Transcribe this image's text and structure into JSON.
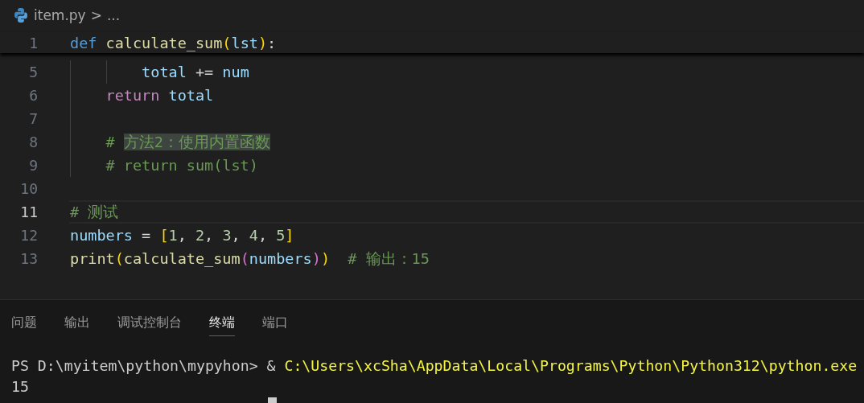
{
  "breadcrumb": {
    "file": "item.py",
    "separator": ">",
    "more": "..."
  },
  "sticky_line": {
    "number": "1",
    "tokens": [
      {
        "text": "def ",
        "kind": "keyword"
      },
      {
        "text": "calculate_sum",
        "kind": "function"
      },
      {
        "text": "(",
        "kind": "bracket"
      },
      {
        "text": "lst",
        "kind": "variable"
      },
      {
        "text": ")",
        "kind": "bracket"
      },
      {
        "text": ":",
        "kind": "plain"
      }
    ]
  },
  "lines": [
    {
      "number": "5",
      "current": false,
      "tokens": [
        {
          "text": "        total",
          "kind": "variable"
        },
        {
          "text": " += ",
          "kind": "plain"
        },
        {
          "text": "num",
          "kind": "variable"
        }
      ]
    },
    {
      "number": "6",
      "current": false,
      "tokens": [
        {
          "text": "    return",
          "kind": "control"
        },
        {
          "text": " total",
          "kind": "variable"
        }
      ]
    },
    {
      "number": "7",
      "current": false
    },
    {
      "number": "8",
      "current": false,
      "tokens": [
        {
          "text": "    # ",
          "kind": "comment"
        },
        {
          "text": "方法2：使用内置函数",
          "kind": "comment_highlight"
        }
      ]
    },
    {
      "number": "9",
      "current": false,
      "tokens": [
        {
          "text": "    # return sum(lst)",
          "kind": "comment"
        }
      ]
    },
    {
      "number": "10",
      "current": false
    },
    {
      "number": "11",
      "current": true,
      "tokens": [
        {
          "text": "# 测试",
          "kind": "comment"
        }
      ]
    },
    {
      "number": "12",
      "current": false,
      "tokens": [
        {
          "text": "numbers",
          "kind": "variable"
        },
        {
          "text": " = ",
          "kind": "plain"
        },
        {
          "text": "[",
          "kind": "bracket"
        },
        {
          "text": "1",
          "kind": "number"
        },
        {
          "text": ", ",
          "kind": "plain"
        },
        {
          "text": "2",
          "kind": "number"
        },
        {
          "text": ", ",
          "kind": "plain"
        },
        {
          "text": "3",
          "kind": "number"
        },
        {
          "text": ", ",
          "kind": "plain"
        },
        {
          "text": "4",
          "kind": "number"
        },
        {
          "text": ", ",
          "kind": "plain"
        },
        {
          "text": "5",
          "kind": "number"
        },
        {
          "text": "]",
          "kind": "bracket"
        }
      ]
    },
    {
      "number": "13",
      "current": false,
      "tokens": [
        {
          "text": "print",
          "kind": "function"
        },
        {
          "text": "(",
          "kind": "bracket"
        },
        {
          "text": "calculate_sum",
          "kind": "function"
        },
        {
          "text": "(",
          "kind": "bracket2"
        },
        {
          "text": "numbers",
          "kind": "variable"
        },
        {
          "text": ")",
          "kind": "bracket2"
        },
        {
          "text": ")",
          "kind": "bracket"
        },
        {
          "text": "  # 输出：15",
          "kind": "comment"
        }
      ]
    }
  ],
  "panel_tabs": [
    {
      "label": "问题",
      "selected": false
    },
    {
      "label": "输出",
      "selected": false
    },
    {
      "label": "调试控制台",
      "selected": false
    },
    {
      "label": "终端",
      "selected": true
    },
    {
      "label": "端口",
      "selected": false
    }
  ],
  "terminal": {
    "lines": [
      {
        "segments": [
          {
            "text": "PS D:\\myitem\\python\\mypyhon> ",
            "kind": "prompt"
          },
          {
            "text": "& ",
            "kind": "prompt"
          },
          {
            "text": "C:\\Users\\xcSha\\AppData\\Local\\Programs\\Python\\Python312\\python.exe",
            "kind": "path"
          }
        ]
      },
      {
        "segments": [
          {
            "text": "15",
            "kind": "prompt"
          }
        ]
      }
    ]
  }
}
